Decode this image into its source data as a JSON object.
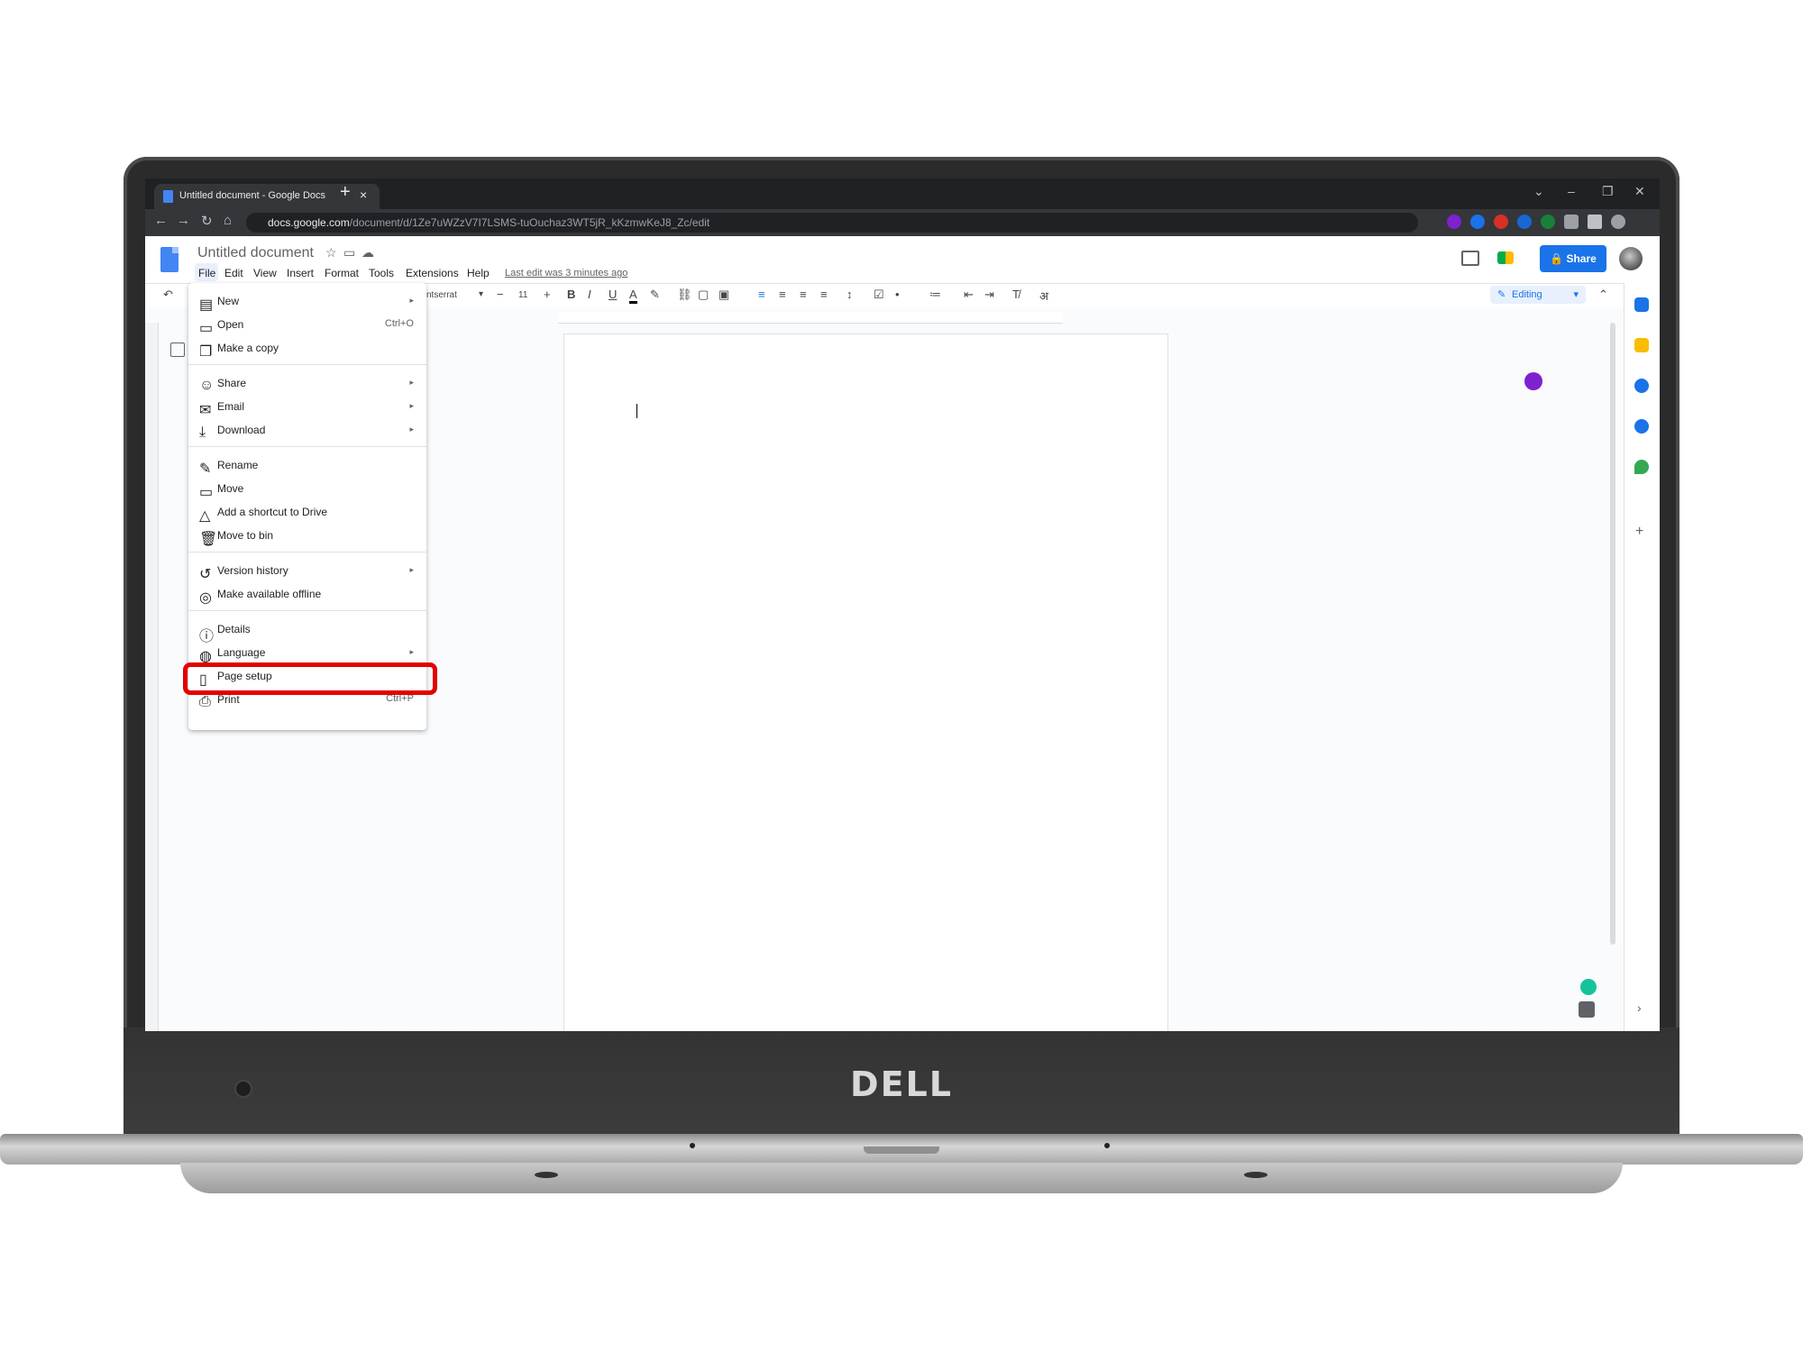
{
  "browser": {
    "tab_title": "Untitled document - Google Docs",
    "tab_close": "×",
    "new_tab": "+",
    "url_domain": "docs.google.com",
    "url_path": "/document/d/1Ze7uWZzV7I7LSMS-tuOuchaz3WT5jR_kKzmwKeJ8_Zc/edit",
    "window_controls": [
      "⌄",
      "–",
      "❐",
      "✕"
    ],
    "nav": [
      "←",
      "→",
      "↻",
      "⌂"
    ]
  },
  "docs": {
    "title": "Untitled document",
    "menus": [
      "File",
      "Edit",
      "View",
      "Insert",
      "Format",
      "Tools",
      "Extensions",
      "Help"
    ],
    "last_edit": "Last edit was 3 minutes ago",
    "share_label": "Share",
    "editing_label": "Editing",
    "font_name": "ntserrat",
    "font_size": "11",
    "brand_color": "#1a73e8"
  },
  "file_menu": {
    "items": [
      {
        "label": "New",
        "shortcut": "",
        "submenu": true,
        "icon": "new-doc-icon"
      },
      {
        "label": "Open",
        "shortcut": "Ctrl+O",
        "submenu": false,
        "icon": "folder-icon"
      },
      {
        "label": "Make a copy",
        "shortcut": "",
        "submenu": false,
        "icon": "copy-icon"
      },
      {
        "label": "Share",
        "shortcut": "",
        "submenu": true,
        "icon": "person-add-icon"
      },
      {
        "label": "Email",
        "shortcut": "",
        "submenu": true,
        "icon": "mail-icon"
      },
      {
        "label": "Download",
        "shortcut": "",
        "submenu": true,
        "icon": "download-icon"
      },
      {
        "label": "Rename",
        "shortcut": "",
        "submenu": false,
        "icon": "pencil-icon"
      },
      {
        "label": "Move",
        "shortcut": "",
        "submenu": false,
        "icon": "move-folder-icon"
      },
      {
        "label": "Add a shortcut to Drive",
        "shortcut": "",
        "submenu": false,
        "icon": "drive-shortcut-icon"
      },
      {
        "label": "Move to bin",
        "shortcut": "",
        "submenu": false,
        "icon": "trash-icon"
      },
      {
        "label": "Version history",
        "shortcut": "",
        "submenu": true,
        "icon": "history-icon"
      },
      {
        "label": "Make available offline",
        "shortcut": "",
        "submenu": false,
        "icon": "offline-icon"
      },
      {
        "label": "Details",
        "shortcut": "",
        "submenu": false,
        "icon": "info-icon"
      },
      {
        "label": "Language",
        "shortcut": "",
        "submenu": true,
        "icon": "globe-icon"
      },
      {
        "label": "Page setup",
        "shortcut": "",
        "submenu": false,
        "icon": "page-icon"
      },
      {
        "label": "Print",
        "shortcut": "Ctrl+P",
        "submenu": false,
        "icon": "printer-icon"
      }
    ],
    "highlighted": "Page setup",
    "highlight_color": "#e30000"
  },
  "laptop": {
    "brand": "DELL"
  }
}
